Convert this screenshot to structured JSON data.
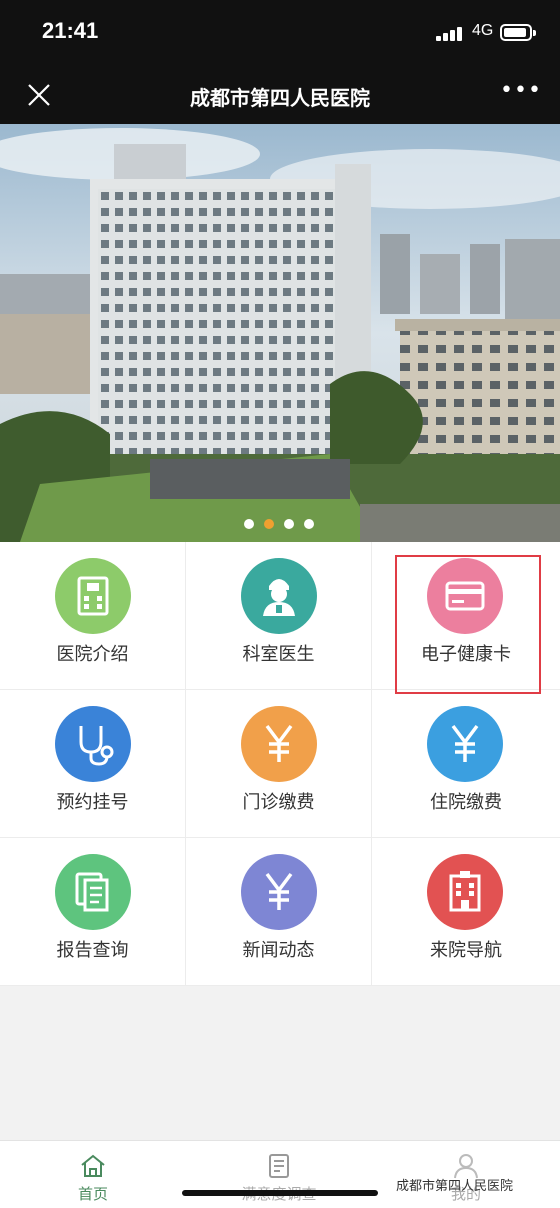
{
  "status_bar": {
    "time": "21:41",
    "network": "4G"
  },
  "nav": {
    "title": "成都市第四人民医院",
    "more": "•••"
  },
  "banner": {
    "slide_count": 4,
    "active_slide": 2
  },
  "grid": {
    "items": [
      {
        "label": "医院介绍",
        "icon": "hospital-icon",
        "color": "#8dcb6a"
      },
      {
        "label": "科室医生",
        "icon": "doctor-icon",
        "color": "#3aa99e"
      },
      {
        "label": "电子健康卡",
        "icon": "card-icon",
        "color": "#ec7f9e"
      },
      {
        "label": "预约挂号",
        "icon": "stethoscope-icon",
        "color": "#3a83d8"
      },
      {
        "label": "门诊缴费",
        "icon": "yuan-icon",
        "color": "#f1a04a"
      },
      {
        "label": "住院缴费",
        "icon": "yuan-icon",
        "color": "#3b9fe0"
      },
      {
        "label": "报告查询",
        "icon": "document-icon",
        "color": "#5ec47e"
      },
      {
        "label": "新闻动态",
        "icon": "yuan-icon",
        "color": "#7e86d4"
      },
      {
        "label": "来院导航",
        "icon": "building-icon",
        "color": "#e25252"
      }
    ]
  },
  "tabs": [
    {
      "label": "首页",
      "icon": "home-icon",
      "active": true
    },
    {
      "label": "满意度调查",
      "icon": "survey-icon",
      "active": false
    },
    {
      "label": "我的",
      "icon": "user-icon",
      "active": false
    }
  ],
  "watermark": "成都市第四人民医院",
  "colors": {
    "accent_green": "#4a8a5e",
    "highlight_red": "#e03c45"
  }
}
